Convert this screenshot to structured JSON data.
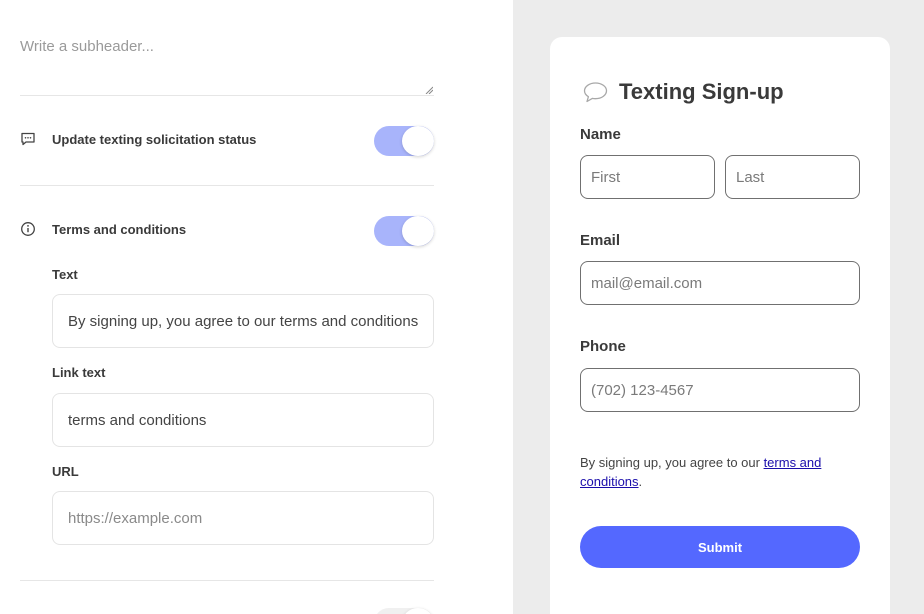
{
  "settings": {
    "subheader_placeholder": "Write a subheader...",
    "solicitation": {
      "label": "Update texting solicitation status",
      "enabled": true
    },
    "terms": {
      "label": "Terms and conditions",
      "enabled": true,
      "text_label": "Text",
      "text_value": "By signing up, you agree to our terms and conditions.",
      "link_text_label": "Link text",
      "link_text_value": "terms and conditions",
      "url_label": "URL",
      "url_placeholder": "https://example.com"
    }
  },
  "preview": {
    "title": "Texting Sign-up",
    "name_label": "Name",
    "first_placeholder": "First",
    "last_placeholder": "Last",
    "email_label": "Email",
    "email_placeholder": "mail@email.com",
    "phone_label": "Phone",
    "phone_placeholder": "(702) 123-4567",
    "consent_prefix": "By signing up, you agree to our ",
    "consent_link": "terms and conditions",
    "consent_suffix": ".",
    "submit_label": "Submit"
  },
  "colors": {
    "accent": "#5468ff",
    "toggle_on": "#a8b4fb",
    "preview_bg": "#ececec"
  }
}
